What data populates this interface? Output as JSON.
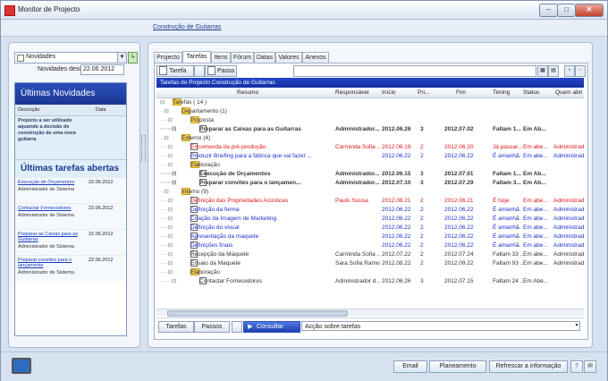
{
  "window": {
    "title": "Monitor de Projecto"
  },
  "banner": {
    "link": "Construção de Guitarras"
  },
  "left": {
    "selected": "Novidades",
    "go_label": "↳",
    "date_label": "Novidades desde",
    "date_value": "22.06.2012",
    "news_title": "Últimas Novidades",
    "col_desc": "Descrição",
    "col_date": "Data",
    "news_text": "Projecto a ser utilizado aquando a decisão de construção de uma nova guitarra",
    "tasks_title": "Últimas tarefas abertas",
    "tasks": [
      {
        "title": "Execução de Orçamentos",
        "user": "Administrador de Sistema",
        "date": "22.06.2012"
      },
      {
        "title": "Contactar Fornecedores",
        "user": "Administrador de Sistema",
        "date": "22.06.2012"
      },
      {
        "title": "Preparar as Caixas para as Guitarras",
        "user": "Administrador de Sistema",
        "date": "22.06.2012"
      },
      {
        "title": "Preparar convites para o lançamento",
        "user": "Administrador de Sistema",
        "date": "22.06.2012"
      }
    ]
  },
  "tabs": [
    "Projecto",
    "Tarefas",
    "Itens",
    "Fórum",
    "Datas",
    "Valores",
    "Anexos"
  ],
  "toolbar": {
    "tarefa": "Tarefa",
    "passo": "Passo"
  },
  "grid": {
    "title": "Tarefas do Projecto Construção de Guitarras",
    "headers": [
      "Resumo",
      "Responsável",
      "Início",
      "Pri...",
      "Fim",
      "Timing",
      "Status",
      "Quem abri"
    ],
    "rows": [
      {
        "indent": 0,
        "kind": "group",
        "resumo": "Tarefas ( 14 )",
        "resp": "",
        "inicio": "",
        "pri": "",
        "fim": "",
        "timing": "",
        "status": "",
        "quem": "",
        "color": "gray",
        "bold": false
      },
      {
        "indent": 1,
        "kind": "group",
        "resumo": "Departamento (1)",
        "resp": "",
        "inicio": "",
        "pri": "",
        "fim": "",
        "timing": "",
        "status": "",
        "quem": "",
        "color": "gray",
        "bold": false
      },
      {
        "indent": 2,
        "kind": "group",
        "resumo": "Proposta",
        "resp": "",
        "inicio": "",
        "pri": "",
        "fim": "",
        "timing": "",
        "status": "",
        "quem": "",
        "color": "gray",
        "bold": false
      },
      {
        "indent": 3,
        "kind": "task",
        "resumo": "Preparar as Caixas para as Guitarras",
        "resp": "Administrador...",
        "inicio": "2012.06.26",
        "pri": "3",
        "fim": "2012.07.02",
        "timing": "Faltam 1...",
        "status": "Em Ab...",
        "quem": "",
        "color": "gray",
        "bold": true
      },
      {
        "indent": 1,
        "kind": "group",
        "resumo": "Externo (4)",
        "resp": "",
        "inicio": "",
        "pri": "",
        "fim": "",
        "timing": "",
        "status": "",
        "quem": "",
        "color": "gray",
        "bold": false
      },
      {
        "indent": 2,
        "kind": "task",
        "resumo": "Encomenda da pré-produção",
        "resp": "Carminda Sofia ...",
        "inicio": "2012.06.19",
        "pri": "2",
        "fim": "2012.06.20",
        "timing": "Já passar...",
        "status": "Em abe...",
        "quem": "Administrad...",
        "color": "red",
        "bold": false
      },
      {
        "indent": 2,
        "kind": "task",
        "resumo": "Produzir Briefing para a fábrica que vai fazer ...",
        "resp": "",
        "inicio": "2012.06.22",
        "pri": "2",
        "fim": "2012.06.22",
        "timing": "É amanhã.",
        "status": "Em abe...",
        "quem": "Administrad...",
        "color": "blue",
        "bold": false
      },
      {
        "indent": 2,
        "kind": "group",
        "resumo": "Elaboração",
        "resp": "",
        "inicio": "",
        "pri": "",
        "fim": "",
        "timing": "",
        "status": "",
        "quem": "",
        "color": "gray",
        "bold": false
      },
      {
        "indent": 3,
        "kind": "task",
        "resumo": "Execução de Orçamentos",
        "resp": "Administrador...",
        "inicio": "2012.06.15",
        "pri": "3",
        "fim": "2012.07.01",
        "timing": "Faltam 1...",
        "status": "Em Ab...",
        "quem": "",
        "color": "gray",
        "bold": true
      },
      {
        "indent": 3,
        "kind": "task",
        "resumo": "Preparar convites para o lançamen...",
        "resp": "Administrador...",
        "inicio": "2012.07.10",
        "pri": "3",
        "fim": "2012.07.29",
        "timing": "Faltam 3...",
        "status": "Em Ab...",
        "quem": "",
        "color": "gray",
        "bold": true
      },
      {
        "indent": 1,
        "kind": "group",
        "resumo": "Interno (9)",
        "resp": "",
        "inicio": "",
        "pri": "",
        "fim": "",
        "timing": "",
        "status": "",
        "quem": "",
        "color": "gray",
        "bold": false
      },
      {
        "indent": 2,
        "kind": "task",
        "resumo": "Definição das Propriedades Acústicas",
        "resp": "Paulo Sousa",
        "inicio": "2012.06.21",
        "pri": "2",
        "fim": "2012.06.21",
        "timing": "É hoje.",
        "status": "Em abe...",
        "quem": "Administrad...",
        "color": "red",
        "bold": false
      },
      {
        "indent": 2,
        "kind": "task",
        "resumo": "Definição da forma",
        "resp": "",
        "inicio": "2012.06.22",
        "pri": "2",
        "fim": "2012.06.22",
        "timing": "É amanhã.",
        "status": "Em abe...",
        "quem": "Administrad...",
        "color": "blue",
        "bold": false
      },
      {
        "indent": 2,
        "kind": "task",
        "resumo": "Criação da Imagem de Marketing",
        "resp": "",
        "inicio": "2012.06.22",
        "pri": "2",
        "fim": "2012.06.22",
        "timing": "É amanhã.",
        "status": "Em abe...",
        "quem": "Administrad...",
        "color": "blue",
        "bold": false
      },
      {
        "indent": 2,
        "kind": "task",
        "resumo": "Definição do visual",
        "resp": "",
        "inicio": "2012.06.22",
        "pri": "2",
        "fim": "2012.06.22",
        "timing": "É amanhã.",
        "status": "Em abe...",
        "quem": "Administrad...",
        "color": "blue",
        "bold": false
      },
      {
        "indent": 2,
        "kind": "task",
        "resumo": "Apresentação da maquete",
        "resp": "",
        "inicio": "2012.06.22",
        "pri": "2",
        "fim": "2012.06.22",
        "timing": "É amanhã.",
        "status": "Em abe...",
        "quem": "Administrad...",
        "color": "blue",
        "bold": false
      },
      {
        "indent": 2,
        "kind": "task",
        "resumo": "Definições finais",
        "resp": "",
        "inicio": "2012.06.22",
        "pri": "2",
        "fim": "2012.06.22",
        "timing": "É amanhã.",
        "status": "Em abe...",
        "quem": "Administrad...",
        "color": "blue",
        "bold": false
      },
      {
        "indent": 2,
        "kind": "task",
        "resumo": "Recepção da Maquete",
        "resp": "Carminda Sofia ...",
        "inicio": "2012.07.22",
        "pri": "2",
        "fim": "2012.07.24",
        "timing": "Faltam 33 ...",
        "status": "Em abe...",
        "quem": "Administrad...",
        "color": "gray",
        "bold": false
      },
      {
        "indent": 2,
        "kind": "task",
        "resumo": "Ensaio da Maquete",
        "resp": "Sara Sofia Ramos",
        "inicio": "2012.08.22",
        "pri": "2",
        "fim": "2012.09.22",
        "timing": "Faltam 93 ...",
        "status": "Em abe...",
        "quem": "Administrad...",
        "color": "gray",
        "bold": false
      },
      {
        "indent": 2,
        "kind": "group",
        "resumo": "Elaboração",
        "resp": "",
        "inicio": "",
        "pri": "",
        "fim": "",
        "timing": "",
        "status": "",
        "quem": "",
        "color": "gray",
        "bold": false
      },
      {
        "indent": 3,
        "kind": "task",
        "resumo": "Contactar Fornecedores",
        "resp": "Administrador d...",
        "inicio": "2012.06.26",
        "pri": "3",
        "fim": "2012.07.15",
        "timing": "Faltam 24 ...",
        "status": "Em Abe...",
        "quem": "",
        "color": "gray",
        "bold": false
      }
    ]
  },
  "bottom": {
    "tarefas": "Tarefas",
    "passos": "Passos",
    "consultar": "Consultar",
    "acao": "Acção sobre tarefas"
  },
  "status": {
    "email": "Email",
    "planeamento": "Planeamento",
    "refrescar": "Refrescar a informação"
  },
  "colors": {
    "overdue": "#e0161b",
    "tomorrow": "#1a2fcf",
    "header": "#1b3691"
  }
}
